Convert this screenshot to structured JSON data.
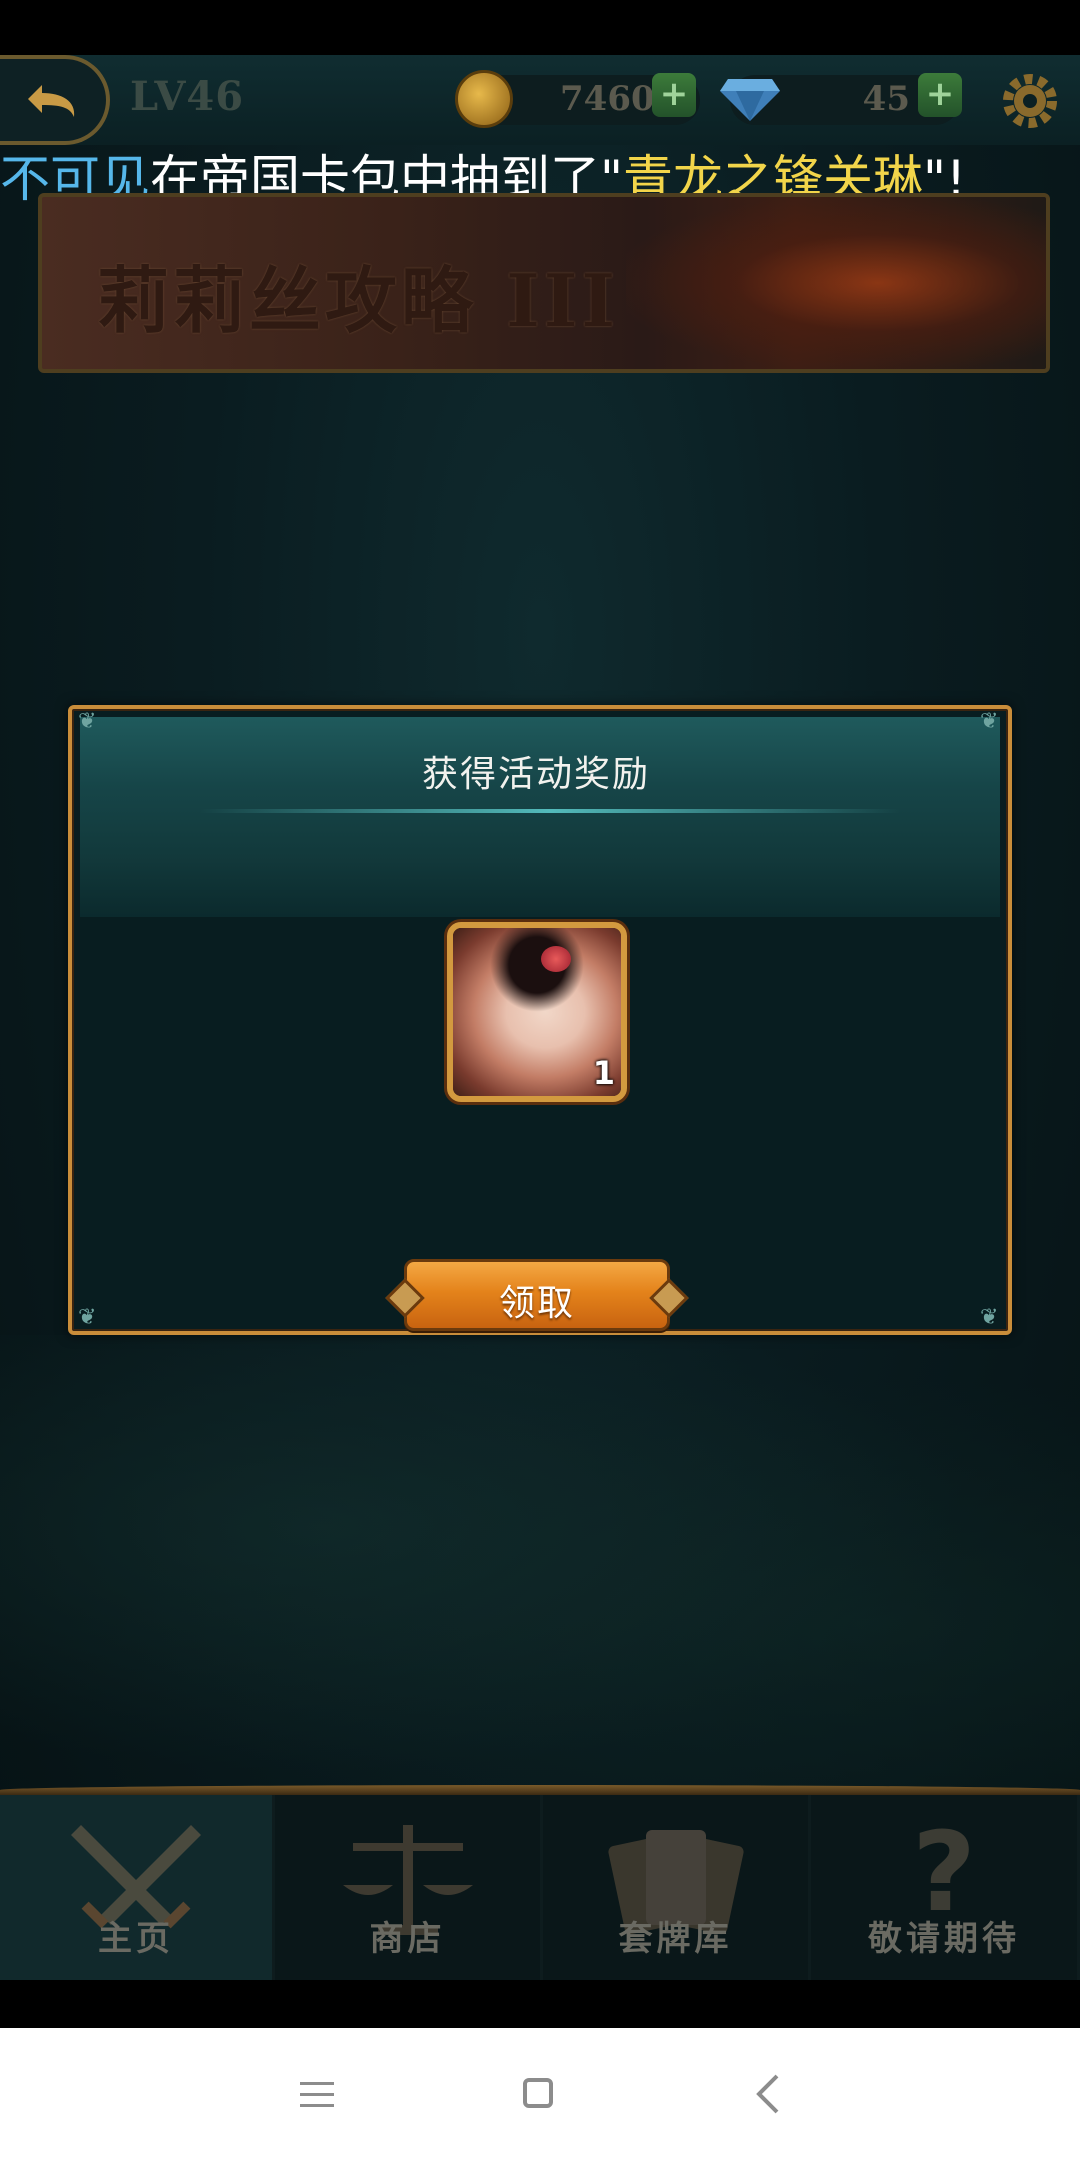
{
  "header": {
    "level": "LV46",
    "gold": "7460",
    "gems": "45",
    "plus": "+"
  },
  "broadcast": {
    "player": "不可见",
    "middle": "在帝国卡包中抽到了\"",
    "card": "青龙之锋关琳",
    "end": "\"!"
  },
  "banner": {
    "title": "莉莉丝攻略 III"
  },
  "dialog": {
    "title": "获得活动奖励",
    "reward_count": "1",
    "claim_label": "领取"
  },
  "tabs": [
    {
      "label": "主页",
      "icon": "crossed-swords-icon",
      "active": true
    },
    {
      "label": "商店",
      "icon": "scales-icon",
      "active": false
    },
    {
      "label": "套牌库",
      "icon": "cards-icon",
      "active": false
    },
    {
      "label": "敬请期待",
      "icon": "question-mark-icon",
      "active": false
    }
  ],
  "colors": {
    "accent_gold": "#c98d3a",
    "player_name": "#56b7ea",
    "card_name": "#f2d54a",
    "button_orange": "#e4831b"
  }
}
